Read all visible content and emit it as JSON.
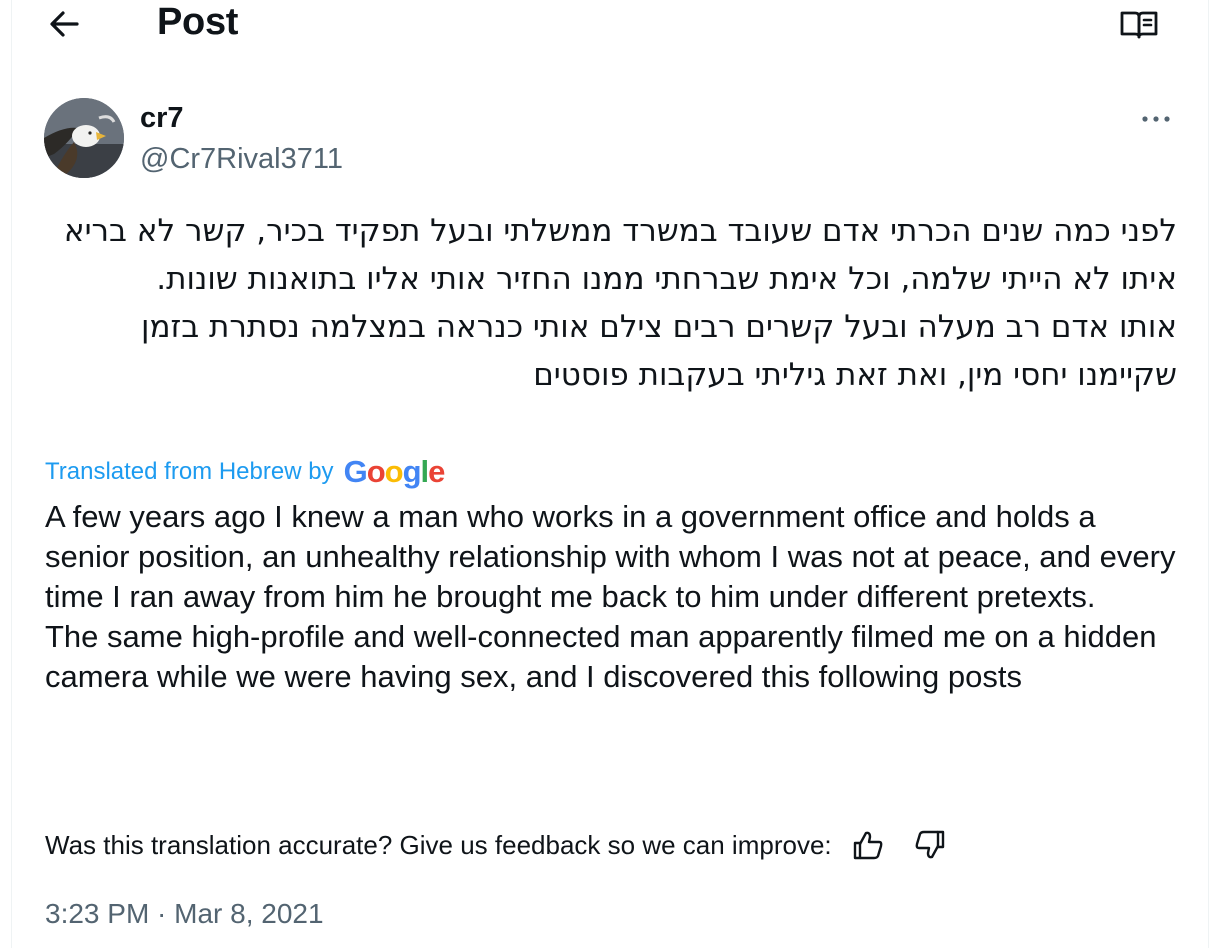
{
  "header": {
    "back_icon": "arrow-left-icon",
    "title": "Post",
    "reader_icon": "open-book-icon"
  },
  "author": {
    "display_name": "cr7",
    "handle": "@Cr7Rival3711",
    "more_icon": "more-horizontal-icon"
  },
  "post": {
    "original_text": "לפני כמה שנים הכרתי אדם שעובד במשרד ממשלתי ובעל תפקיד בכיר, קשר לא בריא איתו לא הייתי שלמה, וכל אימת שברחתי ממנו החזיר אותי אליו בתואנות שונות.\nאותו אדם רב מעלה ובעל קשרים רבים צילם אותי כנראה במצלמה נסתרת בזמן שקיימנו יחסי מין, ואת זאת גיליתי בעקבות פוסטים",
    "translated_label": "Translated from Hebrew by",
    "google_logo": [
      "G",
      "o",
      "o",
      "g",
      "l",
      "e"
    ],
    "translated_text": "A few years ago I knew a man who works in a government office and holds a senior position, an unhealthy relationship with whom I was not at peace, and every time I ran away from him he brought me back to him under different pretexts.\nThe same high-profile and well-connected man apparently filmed me on a hidden camera while we were having sex, and I discovered this following posts",
    "feedback_prompt": "Was this translation accurate? Give us feedback so we can improve:",
    "thumbs_up_icon": "thumbs-up-icon",
    "thumbs_down_icon": "thumbs-down-icon",
    "timestamp": "3:23 PM · Mar 8, 2021"
  },
  "colors": {
    "link_blue": "#1d9bf0",
    "secondary_text": "#536471",
    "primary_text": "#0f1419"
  }
}
